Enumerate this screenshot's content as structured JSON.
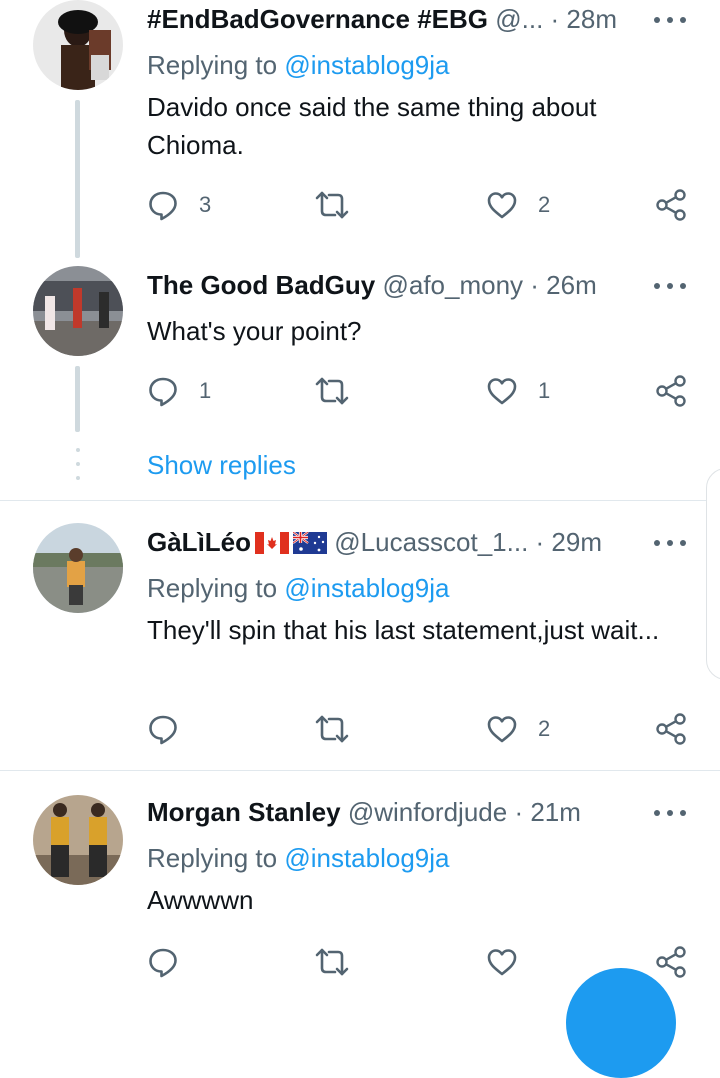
{
  "colors": {
    "accent": "#1d9bf0",
    "text": "#0f1419",
    "secondary": "#536471",
    "thread_line": "#cfd9de"
  },
  "tweets": [
    {
      "name": "#EndBadGovernance #EBG",
      "handle": "@...",
      "time": "· 28m",
      "replying_label": "Replying to",
      "replying_handle": "@instablog9ja",
      "text": "Davido once said the same thing about Chioma.",
      "replies": "3",
      "retweets": "",
      "likes": "2"
    },
    {
      "name": "The Good BadGuy",
      "handle": "@afo_mony",
      "time": "· 26m",
      "text": "What's your point?",
      "replies": "1",
      "retweets": "",
      "likes": "1"
    },
    {
      "name": "GàLìLéo",
      "handle": "@Lucasscot_1...",
      "time": "· 29m",
      "replying_label": "Replying to",
      "replying_handle": "@instablog9ja",
      "text": "They'll spin that his last statement,just wait...",
      "replies": "",
      "retweets": "",
      "likes": "2"
    },
    {
      "name": "Morgan Stanley",
      "handle": "@winfordjude",
      "time": "· 21m",
      "replying_label": "Replying to",
      "replying_handle": "@instablog9ja",
      "text": "Awwwwn",
      "replies": "",
      "retweets": "",
      "likes": ""
    }
  ],
  "show_replies": "Show replies",
  "icons": {
    "reply": "reply-icon",
    "retweet": "retweet-icon",
    "like": "heart-icon",
    "share": "share-icon",
    "more": "more-icon",
    "flags": [
      "canada-flag-icon",
      "australia-flag-icon"
    ]
  }
}
